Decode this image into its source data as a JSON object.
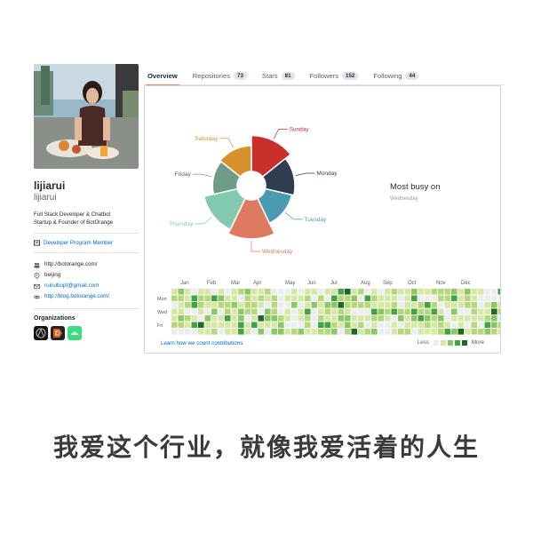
{
  "profile": {
    "name": "lijiarui",
    "login": "lijiarui",
    "bio_line1": "Full Stack Developer & Chatbot",
    "bio_line2": "Startup & Founder of BotOrange",
    "badge": "Developer Program Member",
    "company": "http://botorange.com/",
    "location": "beijing",
    "email": "ruiruibupt@gmail.com",
    "website": "http://blog.botorange.com/",
    "orgs_title": "Organizations",
    "orgs": [
      "org-aui",
      "org-colorful",
      "org-android"
    ]
  },
  "tabs": [
    {
      "label": "Overview",
      "count": ""
    },
    {
      "label": "Repositories",
      "count": "73"
    },
    {
      "label": "Stars",
      "count": "81"
    },
    {
      "label": "Followers",
      "count": "152"
    },
    {
      "label": "Following",
      "count": "44"
    }
  ],
  "chart_data": {
    "type": "pie",
    "categories": [
      "Sunday",
      "Monday",
      "Tuesday",
      "Wednesday",
      "Thursday",
      "Friday",
      "Saturday"
    ],
    "values": [
      0.92,
      0.75,
      0.7,
      1.0,
      0.88,
      0.63,
      0.66
    ],
    "colors": [
      "#c9302c",
      "#2f3e4f",
      "#4a9ab0",
      "#de7a5f",
      "#83c9b0",
      "#6e9c86",
      "#d7932b"
    ],
    "label_colors": [
      "#c9302c",
      "#2f3e4f",
      "#4a9ab0",
      "#de7a5f",
      "#83c9b0",
      "#586069",
      "#d7932b"
    ]
  },
  "busy": {
    "title": "Most busy on",
    "day": "Wednesday"
  },
  "heatmap": {
    "months": [
      "Jan",
      "Feb",
      "Mar",
      "Apr",
      "May",
      "Jun",
      "Jul",
      "Aug",
      "Sep",
      "Oct",
      "Nov",
      "Dec"
    ],
    "days": [
      "Mon",
      "Wed",
      "Fri"
    ],
    "colors": [
      "#ebedf0",
      "#d6e8a5",
      "#b5d97a",
      "#8cc665",
      "#44a340",
      "#1e6823"
    ],
    "learn": "Learn how we count contributions.",
    "less": "Less",
    "more": "More"
  },
  "caption": "我爱这个行业，就像我爱活着的人生"
}
